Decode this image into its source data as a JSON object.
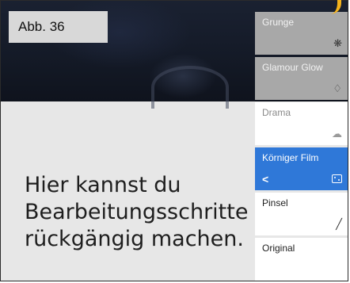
{
  "label": "Abb. 36",
  "caption": [
    "Hier kannst du",
    "Bearbeitungsschritte",
    "rückgängig machen."
  ],
  "filters": [
    {
      "name": "Grunge",
      "icon": "grunge-icon",
      "glyph": "❋"
    },
    {
      "name": "Glamour Glow",
      "icon": "glamour-glow-icon",
      "glyph": "♢"
    },
    {
      "name": "Drama",
      "icon": "drama-cloud-icon",
      "glyph": "☁"
    },
    {
      "name": "Körniger Film",
      "icon": "grain-film-icon",
      "back_glyph": "<"
    },
    {
      "name": "Pinsel",
      "icon": "brush-icon",
      "glyph": "╱"
    },
    {
      "name": "Original"
    }
  ],
  "colors": {
    "active": "#2f78d8",
    "accent": "#f4b21b"
  }
}
